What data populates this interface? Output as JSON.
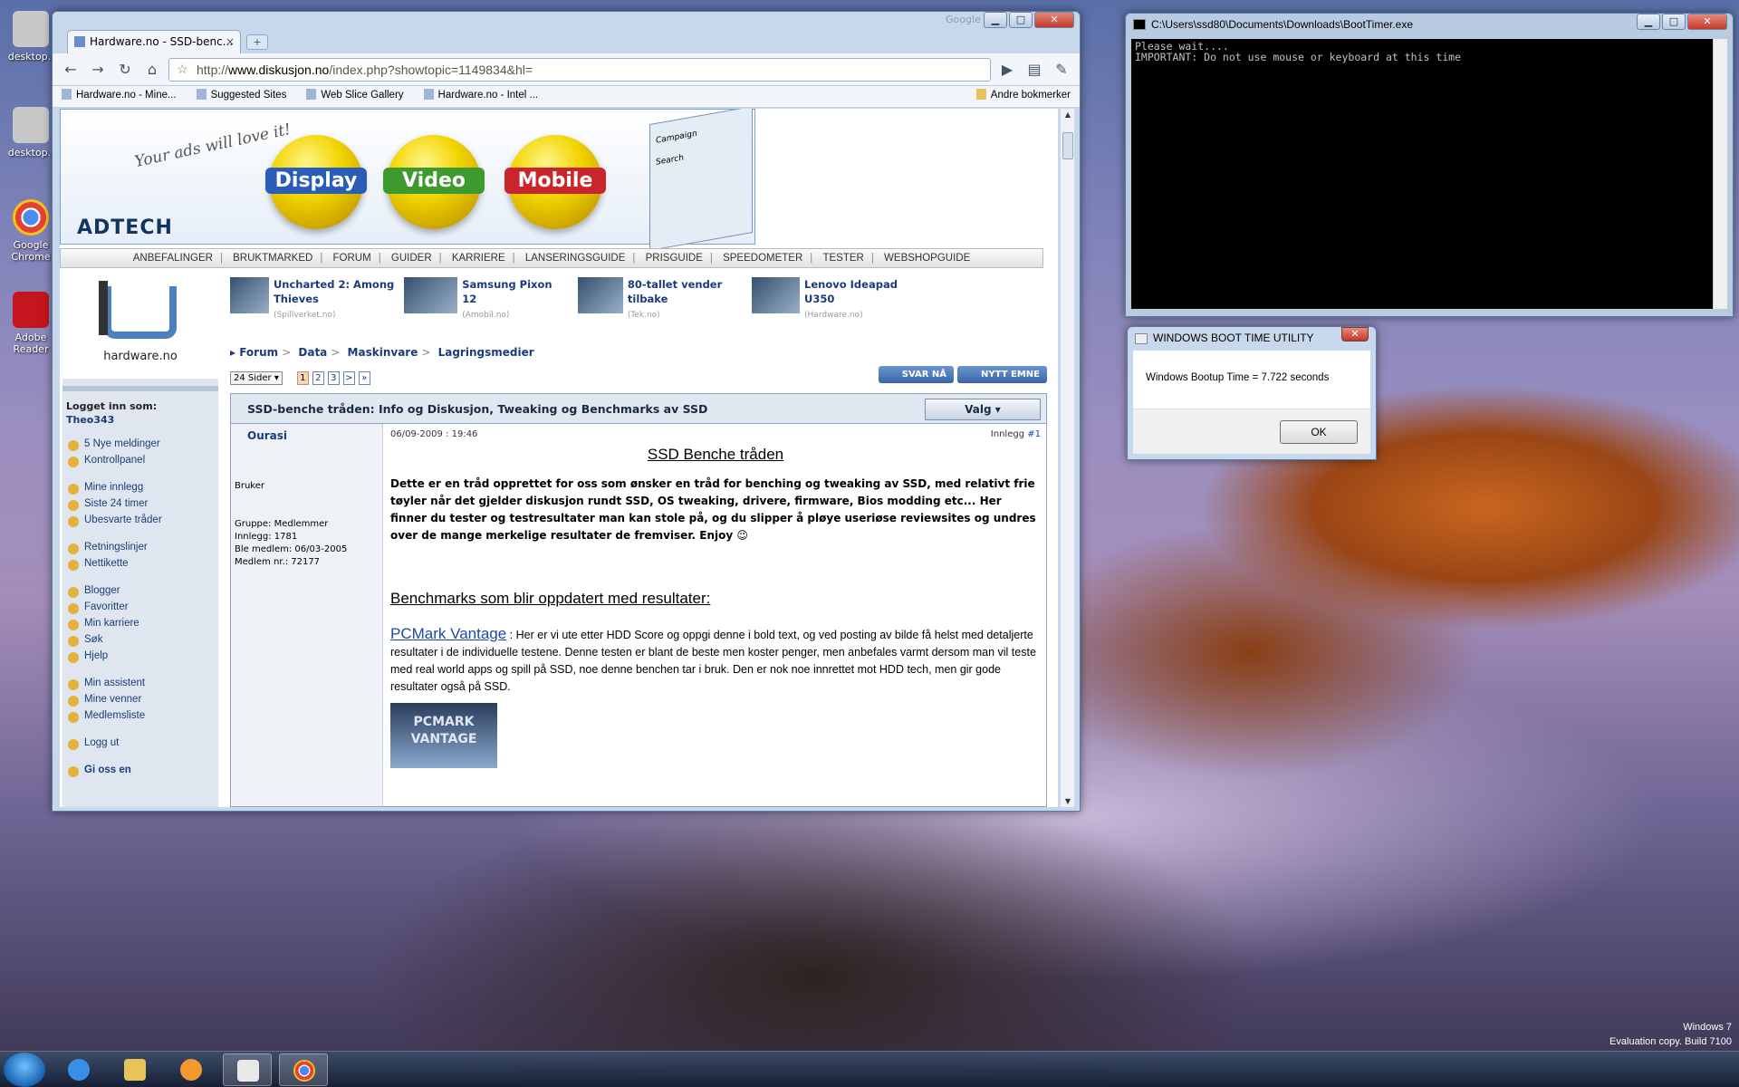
{
  "desktop": {
    "icons": [
      {
        "label": "desktop.i",
        "color": "#c8c8c8"
      },
      {
        "label": "desktop.i",
        "color": "#c8c8c8"
      },
      {
        "label": "Google Chrome",
        "color": "#e34133"
      },
      {
        "label": "Adobe Reader",
        "color": "#c4161c"
      }
    ],
    "watermark": {
      "line1": "Windows 7",
      "line2": "Evaluation copy. Build 7100"
    }
  },
  "browser": {
    "tab_title": "Hardware.no - SSD-benc...",
    "tab_close": "×",
    "new_tab": "+",
    "google_label": "Google",
    "window_buttons": {
      "minimize": "▁",
      "maximize": "□",
      "close": "✕"
    },
    "url_prefix": "http://",
    "url_host": "www.diskusjon.no",
    "url_path": "/index.php?showtopic=1149834&hl=",
    "bookmarks": [
      "Hardware.no - Mine...",
      "Suggested Sites",
      "Web Slice Gallery",
      "Hardware.no - Intel ..."
    ],
    "other_bookmarks": "Andre bokmerker",
    "icons": {
      "back": "back-arrow-icon",
      "forward": "forward-arrow-icon",
      "reload": "reload-icon",
      "home": "home-icon",
      "star": "star-icon",
      "go": "play-icon",
      "page": "page-menu-icon",
      "wrench": "wrench-icon"
    }
  },
  "ad": {
    "tagline": "Your ads will love it!",
    "logo": "ADTECH",
    "balls": [
      {
        "label": "Display",
        "color": "#2a5db8"
      },
      {
        "label": "Video",
        "color": "#3c9a2e"
      },
      {
        "label": "Mobile",
        "color": "#c8252c"
      }
    ],
    "window_lines": [
      "Campaign",
      "Search"
    ]
  },
  "site": {
    "nav": [
      "ANBEFALINGER",
      "BRUKTMARKED",
      "FORUM",
      "GUIDER",
      "KARRIERE",
      "LANSERINGSGUIDE",
      "PRISGUIDE",
      "SPEEDOMETER",
      "TESTER",
      "WEBSHOPGUIDE"
    ],
    "nav_sep": "|",
    "logo_text": "hardware.no",
    "logged_in_label": "Logget inn som:",
    "username": "Theo343",
    "sidebar": {
      "group1": [
        "5 Nye meldinger",
        "Kontrollpanel"
      ],
      "group2": [
        "Mine innlegg",
        "Siste 24 timer",
        "Ubesvarte tråder"
      ],
      "group3": [
        "Retningslinjer",
        "Nettikette"
      ],
      "group4": [
        "Blogger",
        "Favoritter",
        "Min karriere",
        "Søk",
        "Hjelp"
      ],
      "group5": [
        "Min assistent",
        "Mine venner",
        "Medlemsliste"
      ],
      "group6": [
        "Logg ut"
      ],
      "cut_off": "Gi oss en"
    },
    "featured": [
      {
        "title": "Uncharted 2: Among Thieves",
        "source": "(Spillverket.no)"
      },
      {
        "title": "Samsung Pixon 12",
        "source": "(Amobil.no)"
      },
      {
        "title": "80-tallet vender tilbake",
        "source": "(Tek.no)"
      },
      {
        "title": "Lenovo Ideapad U350",
        "source": "(Hardware.no)"
      }
    ],
    "breadcrumb": [
      "Forum",
      "Data",
      "Maskinvare",
      "Lagringsmedier"
    ],
    "breadcrumb_sep": ">",
    "breadcrumb_arrow": "▸",
    "pager": {
      "select": "24 Sider ▾",
      "pages": [
        "1",
        "2",
        "3",
        ">",
        "»"
      ]
    },
    "reply_button": "SVAR NÅ",
    "new_topic_button": "NYTT EMNE",
    "topic_title": "SSD-benche tråden: Info og Diskusjon, Tweaking og Benchmarks av SSD",
    "valg_button": "Valg ▾",
    "post": {
      "author": "Ourasi",
      "role": "Bruker",
      "group": "Gruppe: Medlemmer",
      "posts": "Innlegg: 1781",
      "joined": "Ble medlem: 06/03-2005",
      "member_nr": "Medlem nr.: 72177",
      "date": "06/09-2009 : 19:46",
      "post_label": "Innlegg",
      "post_nr": "#1",
      "title": "SSD Benche tråden",
      "intro": "Dette er en tråd opprettet for oss som ønsker en tråd for benching og tweaking av SSD, med relativt frie tøyler når det gjelder diskusjon rundt SSD, OS tweaking, drivere, firmware, Bios modding etc... Her finner du tester og testresultater man kan stole på, og du slipper å pløye useriøse reviewsites og undres over de mange merkelige resultater de fremviser. Enjoy",
      "emoji": "😉",
      "bench_heading": "Benchmarks som blir oppdatert med resultater:",
      "pcmark_link": "PCMark Vantage",
      "pcmark_text": " : Her er vi ute etter HDD Score og oppgi denne i bold text, og ved posting av bilde få helst med detaljerte resultater i de individuelle testene. Denne testen er blant de beste men koster penger, men anbefales varmt dersom man vil teste med real world apps og spill på SSD, noe denne benchen tar i bruk. Den er nok noe innrettet mot HDD tech, men gir gode resultater også på SSD.",
      "pcmark_image_label": "PCMARK VANTAGE"
    }
  },
  "console": {
    "title": "C:\\Users\\ssd80\\Documents\\Downloads\\BootTimer.exe",
    "text": "Please wait....\nIMPORTANT: Do not use mouse or keyboard at this time"
  },
  "dialog": {
    "title": "WINDOWS BOOT TIME UTILITY",
    "message": "Windows Bootup Time =  7.722  seconds",
    "ok": "OK",
    "close": "✕"
  },
  "taskbar": {
    "icons": [
      "windows-start-icon",
      "internet-explorer-icon",
      "folder-icon",
      "media-player-icon",
      "console-icon",
      "chrome-icon"
    ],
    "colors": {
      "ie": "#3a8ee6",
      "folder": "#e8c35a",
      "media": "#f29a2e",
      "console": "#e9e9e9",
      "chrome": "#e34133"
    }
  }
}
